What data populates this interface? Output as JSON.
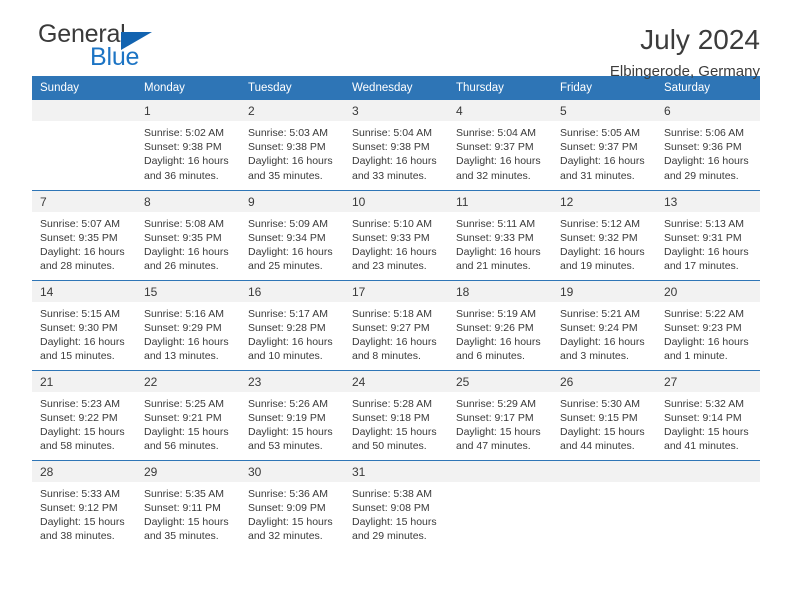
{
  "brand": {
    "name_top": "General",
    "name_bottom": "Blue",
    "color_blue": "#1c74c4",
    "color_triangle": "#1263b0"
  },
  "header": {
    "title": "July 2024",
    "location": "Elbingerode, Germany"
  },
  "calendar": {
    "header_color": "#2e75b6",
    "weekdays": [
      "Sunday",
      "Monday",
      "Tuesday",
      "Wednesday",
      "Thursday",
      "Friday",
      "Saturday"
    ],
    "weeks": [
      [
        {
          "day": "",
          "sunrise": "",
          "sunset": "",
          "daylight_1": "",
          "daylight_2": ""
        },
        {
          "day": "1",
          "sunrise": "Sunrise: 5:02 AM",
          "sunset": "Sunset: 9:38 PM",
          "daylight_1": "Daylight: 16 hours",
          "daylight_2": "and 36 minutes."
        },
        {
          "day": "2",
          "sunrise": "Sunrise: 5:03 AM",
          "sunset": "Sunset: 9:38 PM",
          "daylight_1": "Daylight: 16 hours",
          "daylight_2": "and 35 minutes."
        },
        {
          "day": "3",
          "sunrise": "Sunrise: 5:04 AM",
          "sunset": "Sunset: 9:38 PM",
          "daylight_1": "Daylight: 16 hours",
          "daylight_2": "and 33 minutes."
        },
        {
          "day": "4",
          "sunrise": "Sunrise: 5:04 AM",
          "sunset": "Sunset: 9:37 PM",
          "daylight_1": "Daylight: 16 hours",
          "daylight_2": "and 32 minutes."
        },
        {
          "day": "5",
          "sunrise": "Sunrise: 5:05 AM",
          "sunset": "Sunset: 9:37 PM",
          "daylight_1": "Daylight: 16 hours",
          "daylight_2": "and 31 minutes."
        },
        {
          "day": "6",
          "sunrise": "Sunrise: 5:06 AM",
          "sunset": "Sunset: 9:36 PM",
          "daylight_1": "Daylight: 16 hours",
          "daylight_2": "and 29 minutes."
        }
      ],
      [
        {
          "day": "7",
          "sunrise": "Sunrise: 5:07 AM",
          "sunset": "Sunset: 9:35 PM",
          "daylight_1": "Daylight: 16 hours",
          "daylight_2": "and 28 minutes."
        },
        {
          "day": "8",
          "sunrise": "Sunrise: 5:08 AM",
          "sunset": "Sunset: 9:35 PM",
          "daylight_1": "Daylight: 16 hours",
          "daylight_2": "and 26 minutes."
        },
        {
          "day": "9",
          "sunrise": "Sunrise: 5:09 AM",
          "sunset": "Sunset: 9:34 PM",
          "daylight_1": "Daylight: 16 hours",
          "daylight_2": "and 25 minutes."
        },
        {
          "day": "10",
          "sunrise": "Sunrise: 5:10 AM",
          "sunset": "Sunset: 9:33 PM",
          "daylight_1": "Daylight: 16 hours",
          "daylight_2": "and 23 minutes."
        },
        {
          "day": "11",
          "sunrise": "Sunrise: 5:11 AM",
          "sunset": "Sunset: 9:33 PM",
          "daylight_1": "Daylight: 16 hours",
          "daylight_2": "and 21 minutes."
        },
        {
          "day": "12",
          "sunrise": "Sunrise: 5:12 AM",
          "sunset": "Sunset: 9:32 PM",
          "daylight_1": "Daylight: 16 hours",
          "daylight_2": "and 19 minutes."
        },
        {
          "day": "13",
          "sunrise": "Sunrise: 5:13 AM",
          "sunset": "Sunset: 9:31 PM",
          "daylight_1": "Daylight: 16 hours",
          "daylight_2": "and 17 minutes."
        }
      ],
      [
        {
          "day": "14",
          "sunrise": "Sunrise: 5:15 AM",
          "sunset": "Sunset: 9:30 PM",
          "daylight_1": "Daylight: 16 hours",
          "daylight_2": "and 15 minutes."
        },
        {
          "day": "15",
          "sunrise": "Sunrise: 5:16 AM",
          "sunset": "Sunset: 9:29 PM",
          "daylight_1": "Daylight: 16 hours",
          "daylight_2": "and 13 minutes."
        },
        {
          "day": "16",
          "sunrise": "Sunrise: 5:17 AM",
          "sunset": "Sunset: 9:28 PM",
          "daylight_1": "Daylight: 16 hours",
          "daylight_2": "and 10 minutes."
        },
        {
          "day": "17",
          "sunrise": "Sunrise: 5:18 AM",
          "sunset": "Sunset: 9:27 PM",
          "daylight_1": "Daylight: 16 hours",
          "daylight_2": "and 8 minutes."
        },
        {
          "day": "18",
          "sunrise": "Sunrise: 5:19 AM",
          "sunset": "Sunset: 9:26 PM",
          "daylight_1": "Daylight: 16 hours",
          "daylight_2": "and 6 minutes."
        },
        {
          "day": "19",
          "sunrise": "Sunrise: 5:21 AM",
          "sunset": "Sunset: 9:24 PM",
          "daylight_1": "Daylight: 16 hours",
          "daylight_2": "and 3 minutes."
        },
        {
          "day": "20",
          "sunrise": "Sunrise: 5:22 AM",
          "sunset": "Sunset: 9:23 PM",
          "daylight_1": "Daylight: 16 hours",
          "daylight_2": "and 1 minute."
        }
      ],
      [
        {
          "day": "21",
          "sunrise": "Sunrise: 5:23 AM",
          "sunset": "Sunset: 9:22 PM",
          "daylight_1": "Daylight: 15 hours",
          "daylight_2": "and 58 minutes."
        },
        {
          "day": "22",
          "sunrise": "Sunrise: 5:25 AM",
          "sunset": "Sunset: 9:21 PM",
          "daylight_1": "Daylight: 15 hours",
          "daylight_2": "and 56 minutes."
        },
        {
          "day": "23",
          "sunrise": "Sunrise: 5:26 AM",
          "sunset": "Sunset: 9:19 PM",
          "daylight_1": "Daylight: 15 hours",
          "daylight_2": "and 53 minutes."
        },
        {
          "day": "24",
          "sunrise": "Sunrise: 5:28 AM",
          "sunset": "Sunset: 9:18 PM",
          "daylight_1": "Daylight: 15 hours",
          "daylight_2": "and 50 minutes."
        },
        {
          "day": "25",
          "sunrise": "Sunrise: 5:29 AM",
          "sunset": "Sunset: 9:17 PM",
          "daylight_1": "Daylight: 15 hours",
          "daylight_2": "and 47 minutes."
        },
        {
          "day": "26",
          "sunrise": "Sunrise: 5:30 AM",
          "sunset": "Sunset: 9:15 PM",
          "daylight_1": "Daylight: 15 hours",
          "daylight_2": "and 44 minutes."
        },
        {
          "day": "27",
          "sunrise": "Sunrise: 5:32 AM",
          "sunset": "Sunset: 9:14 PM",
          "daylight_1": "Daylight: 15 hours",
          "daylight_2": "and 41 minutes."
        }
      ],
      [
        {
          "day": "28",
          "sunrise": "Sunrise: 5:33 AM",
          "sunset": "Sunset: 9:12 PM",
          "daylight_1": "Daylight: 15 hours",
          "daylight_2": "and 38 minutes."
        },
        {
          "day": "29",
          "sunrise": "Sunrise: 5:35 AM",
          "sunset": "Sunset: 9:11 PM",
          "daylight_1": "Daylight: 15 hours",
          "daylight_2": "and 35 minutes."
        },
        {
          "day": "30",
          "sunrise": "Sunrise: 5:36 AM",
          "sunset": "Sunset: 9:09 PM",
          "daylight_1": "Daylight: 15 hours",
          "daylight_2": "and 32 minutes."
        },
        {
          "day": "31",
          "sunrise": "Sunrise: 5:38 AM",
          "sunset": "Sunset: 9:08 PM",
          "daylight_1": "Daylight: 15 hours",
          "daylight_2": "and 29 minutes."
        },
        {
          "day": "",
          "sunrise": "",
          "sunset": "",
          "daylight_1": "",
          "daylight_2": ""
        },
        {
          "day": "",
          "sunrise": "",
          "sunset": "",
          "daylight_1": "",
          "daylight_2": ""
        },
        {
          "day": "",
          "sunrise": "",
          "sunset": "",
          "daylight_1": "",
          "daylight_2": ""
        }
      ]
    ]
  }
}
